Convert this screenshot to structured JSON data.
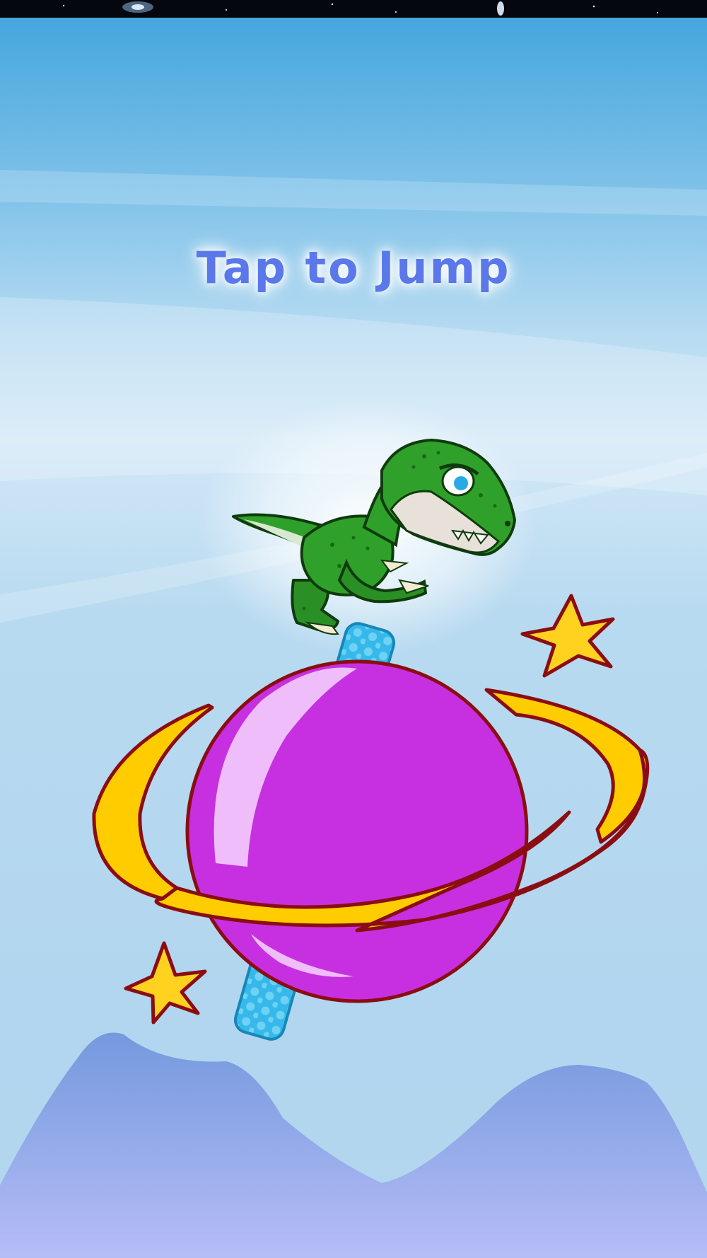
{
  "screen": {
    "name": "start-screen",
    "prompt_text": "Tap to Jump"
  },
  "sprites": {
    "player": "green-dinosaur",
    "platform": "purple-ringed-planet",
    "decorations": [
      "star",
      "star",
      "cloud-streaks",
      "mountains",
      "space-strip"
    ]
  },
  "colors": {
    "prompt_text": "#5a78ea",
    "dino_green": "#2fa12a",
    "planet_purple": "#c730e0",
    "ring_yellow": "#ffcc00",
    "outline_red": "#8a0d12",
    "pillar_cyan": "#3bbbe8",
    "mountain_blue": "#8aa8e4"
  }
}
